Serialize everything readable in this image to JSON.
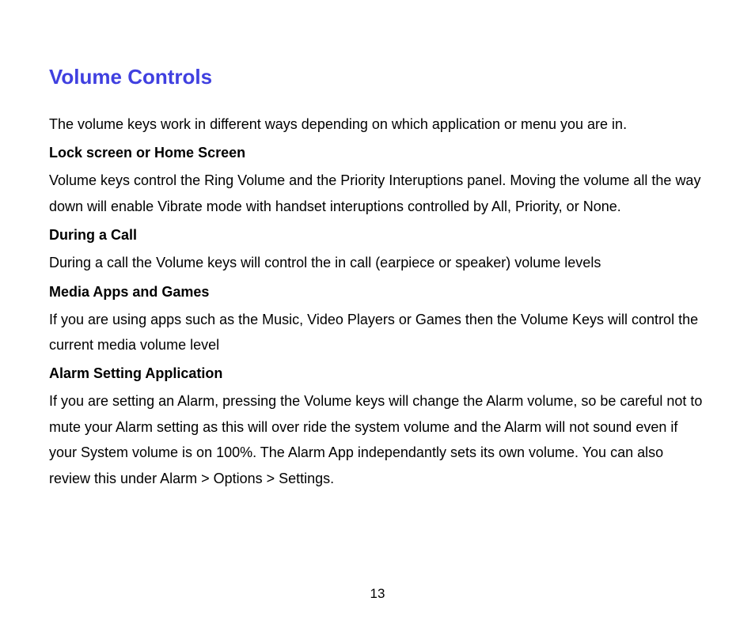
{
  "title": "Volume Controls",
  "intro": "The volume keys work in different ways depending on which application or menu you are in.",
  "sections": [
    {
      "heading": "Lock screen or Home Screen",
      "body": "Volume keys control the Ring Volume and the Priority Interuptions panel.\nMoving the volume all the way down will enable Vibrate mode with handset interuptions controlled by All, Priority, or None."
    },
    {
      "heading": "During a Call",
      "body": "During a call the Volume keys will control the in call (earpiece or speaker) volume levels"
    },
    {
      "heading": "Media Apps and Games",
      "body": "If you are using apps such as the Music, Video Players or Games then the Volume Keys will control the current media volume level"
    },
    {
      "heading": "Alarm Setting Application",
      "body": "If you are setting an Alarm, pressing the Volume keys will change the Alarm volume, so be careful not to mute your Alarm setting as this will over ride the system volume and the Alarm will not sound even if your System volume is on 100%. The Alarm App independantly sets its own volume. You can also review this under Alarm > Options > Settings."
    }
  ],
  "pageNumber": "13"
}
